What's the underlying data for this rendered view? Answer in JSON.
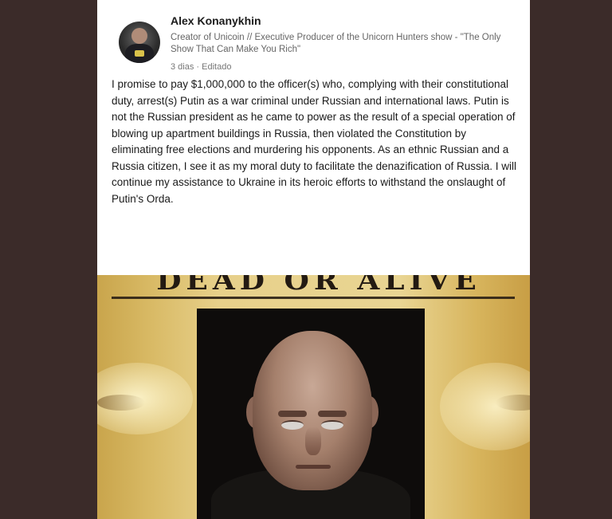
{
  "post": {
    "author": "Alex Konanykhin",
    "headline": "Creator of Unicoin // Executive Producer of the Unicorn Hunters show - \"The Only Show That Can Make You Rich\"",
    "meta": "3 dias · Editado",
    "text": "I promise to pay $1,000,000 to the officer(s) who, complying with their constitutional duty, arrest(s) Putin as a war criminal under Russian and international laws. Putin is not the Russian president as he came to power as the result of a special operation of blowing up apartment buildings in Russia, then violated the Constitution by eliminating free elections and murdering his opponents. As an ethnic Russian and a Russia citizen, I see it as my moral duty to facilitate the denazification of Russia. I will continue my assistance to Ukraine in its heroic efforts to withstand the onslaught of Putin's Orda."
  },
  "poster": {
    "title": "DEAD OR ALIVE"
  }
}
